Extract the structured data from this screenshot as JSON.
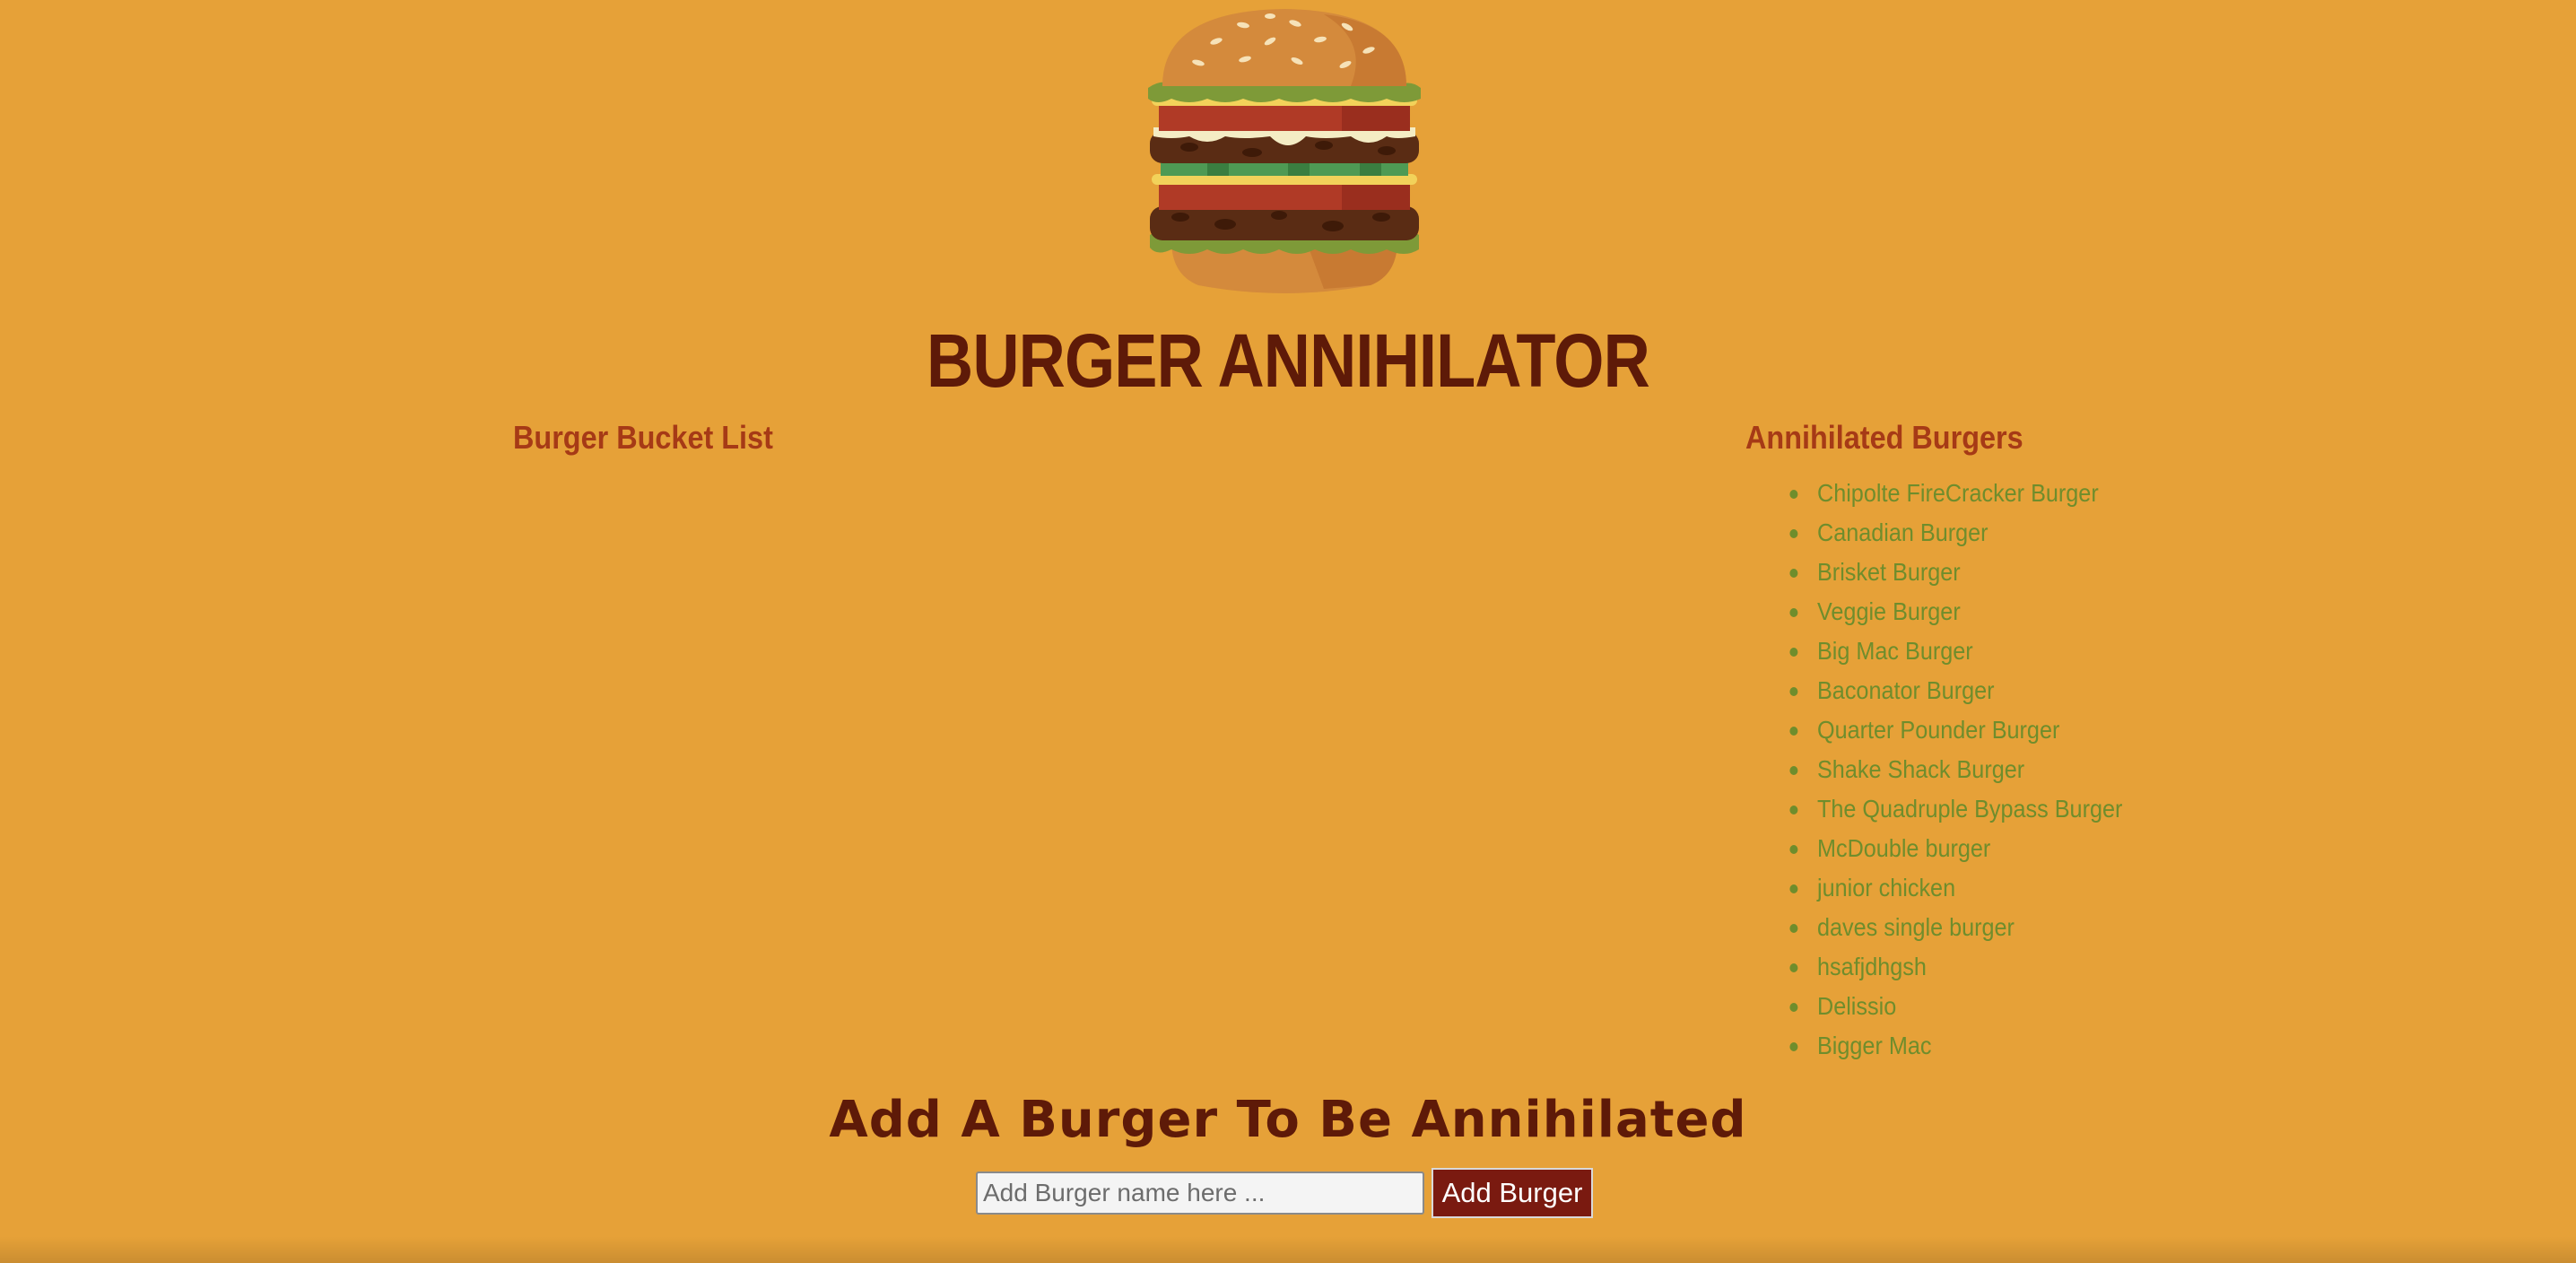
{
  "header": {
    "logo_icon": "burger-logo-icon",
    "title": "BURGER ANNIHILATOR"
  },
  "bucket_list": {
    "heading": "Burger Bucket List",
    "items": []
  },
  "annihilated": {
    "heading": "Annihilated Burgers",
    "items": [
      "Chipolte FireCracker Burger",
      "Canadian Burger",
      "Brisket Burger",
      "Veggie Burger",
      "Big Mac Burger",
      "Baconator Burger",
      "Quarter Pounder Burger",
      "Shake Shack Burger",
      "The Quadruple Bypass Burger",
      "McDouble burger",
      "junior chicken",
      "daves single burger",
      "hsafjdhgsh",
      "Delissio",
      "Bigger Mac"
    ]
  },
  "add_form": {
    "heading": "Add A Burger To Be Annihilated",
    "input_value": "",
    "input_placeholder": "Add Burger name here ...",
    "button_label": "Add Burger"
  },
  "colors": {
    "background": "#e6a138",
    "title": "#5e1a08",
    "column_heading": "#a63a16",
    "list_item": "#6f8d2c",
    "button_bg": "#7a1a10"
  }
}
